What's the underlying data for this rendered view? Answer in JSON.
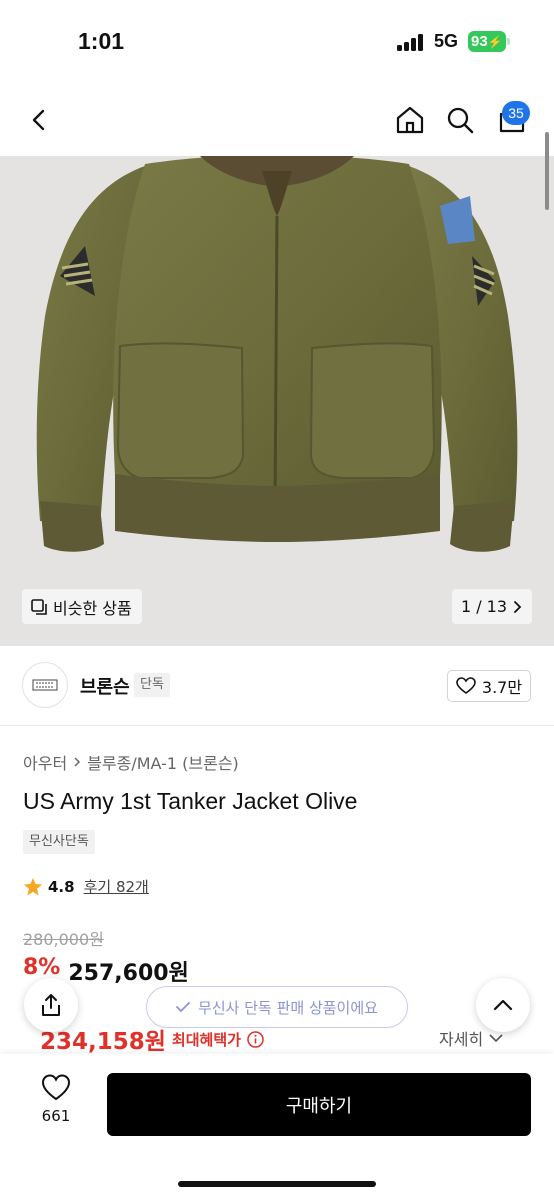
{
  "status_bar": {
    "time": "1:01",
    "network": "5G",
    "battery": "93"
  },
  "nav": {
    "cart_count": "35",
    "icons": [
      "back-icon",
      "home-icon",
      "search-icon",
      "cart-icon"
    ]
  },
  "gallery": {
    "similar_label": "비슷한 상품",
    "counter": "1 / 13"
  },
  "brand": {
    "name": "브론슨",
    "tag": "단독",
    "likes": "3.7만"
  },
  "breadcrumb": {
    "category": "아우터",
    "subcategory": "블루종/MA-1 (브론슨)"
  },
  "product": {
    "title": "US Army 1st Tanker Jacket Olive",
    "exclusive_tag": "무신사단독",
    "rating": "4.8",
    "reviews": "후기 82개"
  },
  "price": {
    "original": "280,000원",
    "discount": "8%",
    "sale": "257,600원",
    "max_benefit": "234,158원",
    "max_label": "최대혜택가",
    "detail_label": "자세히"
  },
  "toast": {
    "text": "무신사 단독 판매 상품이에요"
  },
  "bottom": {
    "wish_count": "661",
    "buy_label": "구매하기"
  },
  "colors": {
    "accent_red": "#e0302a",
    "badge_blue": "#1e74e8",
    "olive": "#6b6b3a"
  }
}
